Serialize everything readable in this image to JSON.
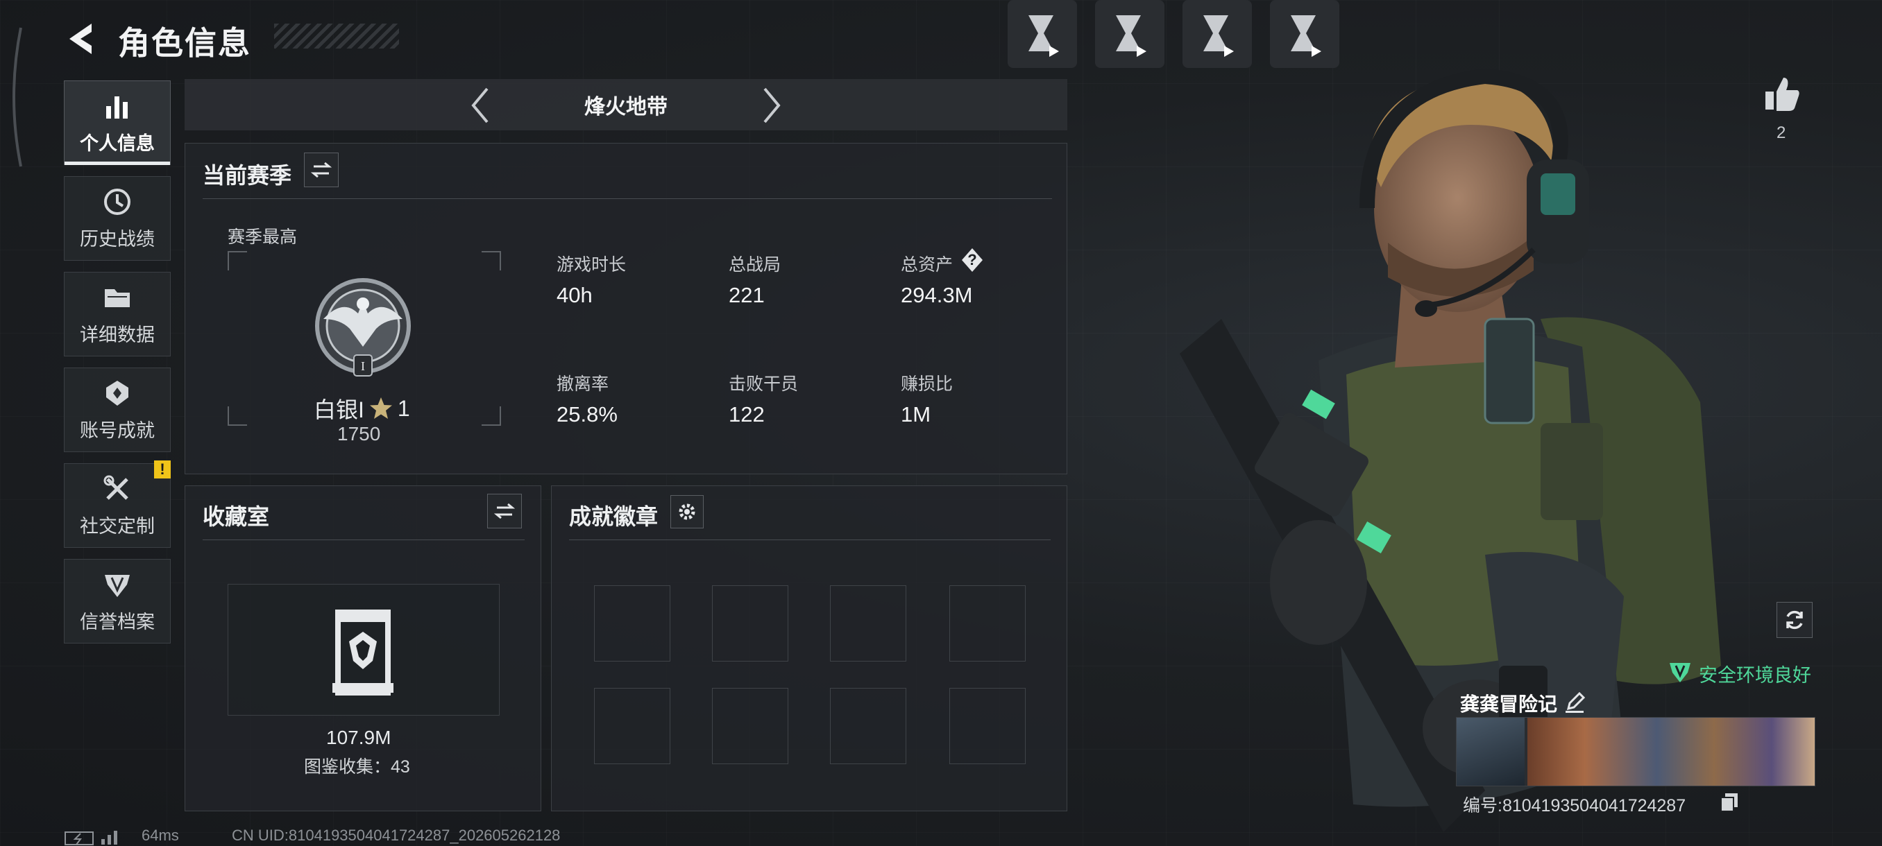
{
  "header": {
    "title": "角色信息"
  },
  "sidebar": {
    "items": [
      {
        "label": "个人信息",
        "icon": "bar-chart-icon",
        "active": true
      },
      {
        "label": "历史战绩",
        "icon": "history-clock-icon"
      },
      {
        "label": "详细数据",
        "icon": "folder-icon"
      },
      {
        "label": "账号成就",
        "icon": "achievement-icon"
      },
      {
        "label": "社交定制",
        "icon": "tools-icon",
        "badge": "!"
      },
      {
        "label": "信誉档案",
        "icon": "reputation-shield-icon"
      }
    ]
  },
  "mode": {
    "title": "烽火地带"
  },
  "season": {
    "title": "当前赛季",
    "best_label": "赛季最高",
    "rank_name": "白银I",
    "rank_stars": "1",
    "rank_score": "1750",
    "stats": [
      {
        "label": "游戏时长",
        "value": "40h"
      },
      {
        "label": "总战局",
        "value": "221"
      },
      {
        "label": "总资产",
        "value": "294.3M",
        "help": "?"
      },
      {
        "label": "撤离率",
        "value": "25.8%"
      },
      {
        "label": "击败干员",
        "value": "122"
      },
      {
        "label": "赚损比",
        "value": "1M"
      }
    ]
  },
  "collection": {
    "title": "收藏室",
    "value": "107.9M",
    "catalog_text": "图鉴收集：43"
  },
  "badges": {
    "title": "成就徽章",
    "slot_count": 8
  },
  "profile": {
    "likes": "2",
    "safe_status": "安全环境良好",
    "player_name": "龚龚冒险记",
    "player_id": "编号:8104193504041724287"
  },
  "status_bar": {
    "ping": "64ms",
    "uid": "CN UID:8104193504041724287_202605262128"
  },
  "colors": {
    "accent_green": "#4fd89a",
    "warning_yellow": "#f0c419",
    "active_underline": "#e9ecee"
  }
}
